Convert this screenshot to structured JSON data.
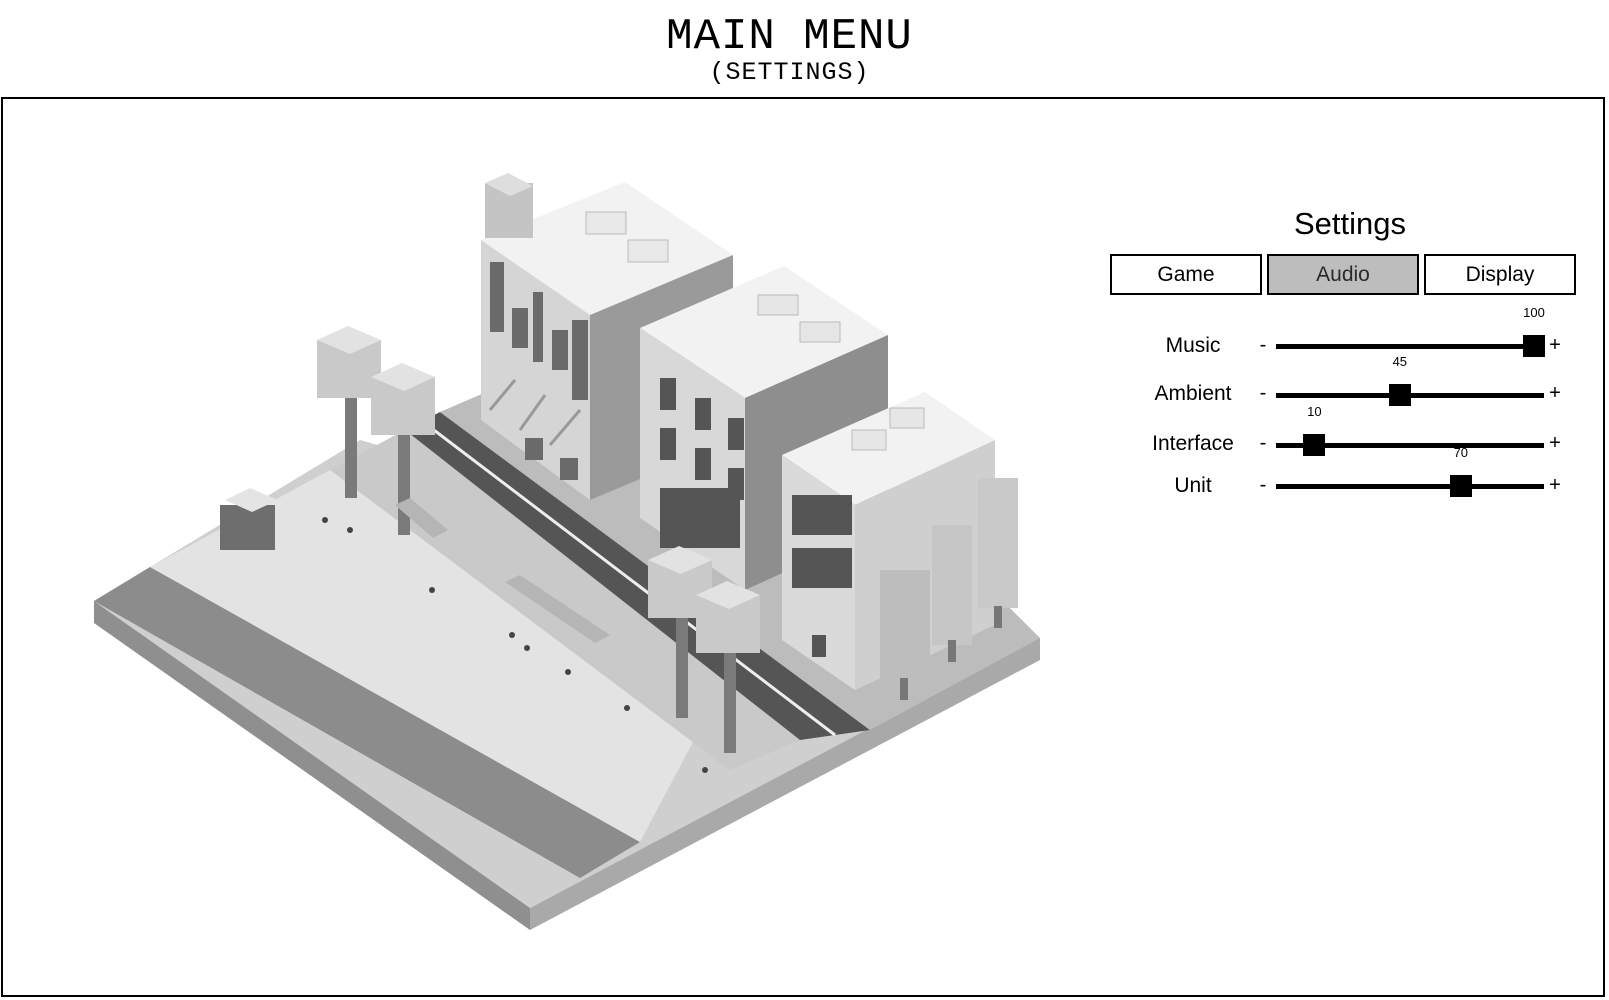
{
  "header": {
    "title": "MAIN MENU",
    "subtitle": "(SETTINGS)"
  },
  "settings": {
    "heading": "Settings",
    "tabs": [
      {
        "label": "Game",
        "active": false
      },
      {
        "label": "Audio",
        "active": true
      },
      {
        "label": "Display",
        "active": false
      }
    ],
    "sliders": [
      {
        "label": "Music",
        "value": 100,
        "value_text": "100",
        "max": 100,
        "minus": "-",
        "plus": "+"
      },
      {
        "label": "Ambient",
        "value": 45,
        "value_text": "45",
        "max": 100,
        "minus": "-",
        "plus": "+"
      },
      {
        "label": "Interface",
        "value": 10,
        "value_text": "10",
        "max": 100,
        "minus": "-",
        "plus": "+"
      },
      {
        "label": "Unit",
        "value": 70,
        "value_text": "70",
        "max": 100,
        "minus": "-",
        "plus": "+"
      }
    ]
  },
  "scene": {
    "description_icon": "isometric-voxel-street-icon"
  },
  "colors": {
    "active_tab": "#bdbdbd",
    "frame": "#000000",
    "knob": "#000000"
  }
}
